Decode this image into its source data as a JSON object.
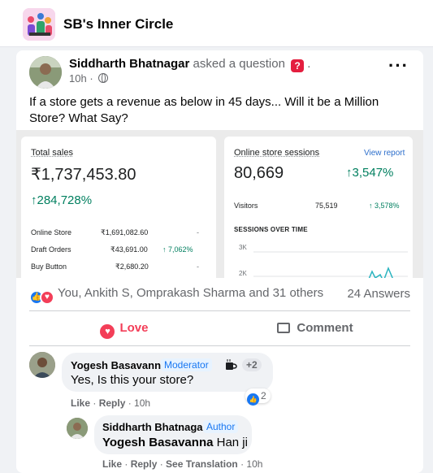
{
  "group": {
    "name": "SB's Inner Circle"
  },
  "post": {
    "author": "Siddharth Bhatnagar",
    "action": "asked a question",
    "time": "10h",
    "privacy_sep": "·",
    "text": "If a store gets a revenue as below in 45 days... Will it be a Million Store?  What Say?",
    "more_icon": "more-horizontal-icon"
  },
  "analytics": {
    "total_sales": {
      "label": "Total sales",
      "value": "₹1,737,453.80",
      "growth": "↑284,728%",
      "rows": [
        {
          "label": "Online Store",
          "value": "₹1,691,082.60",
          "growth": "-"
        },
        {
          "label": "Draft Orders",
          "value": "₹43,691.00",
          "growth": "↑ 7,062%"
        },
        {
          "label": "Buy Button",
          "value": "₹2,680.20",
          "growth": "-"
        }
      ]
    },
    "sessions": {
      "label": "Online store sessions",
      "link": "View report",
      "value": "80,669",
      "growth": "↑3,547%",
      "visitors_label": "Visitors",
      "visitors_value": "75,519",
      "visitors_growth": "↑ 3,578%",
      "chart_title": "SESSIONS OVER TIME",
      "axis_top": "3K",
      "axis_mid": "2K"
    }
  },
  "reactions": {
    "summary": "You, Ankith S, Omprakash Sharma and 31 others",
    "answers": "24 Answers"
  },
  "actions": {
    "love": "Love",
    "comment": "Comment"
  },
  "comments": [
    {
      "author": "Yogesh Basavanna",
      "badge": "Moderator",
      "extra": "+2",
      "text": "Yes, Is this your store?",
      "like": "Like",
      "reply": "Reply",
      "time": "10h",
      "likes": "2"
    },
    {
      "author": "Siddharth Bhatnagar",
      "badge": "Author",
      "mention": "Yogesh Basavanna",
      "text": "Han ji",
      "like": "Like",
      "reply": "Reply",
      "translation": "See Translation",
      "time": "10h"
    }
  ],
  "colors": {
    "facebook_blue": "#1877f2",
    "love_red": "#f33e58",
    "growth_green": "#007f5f"
  }
}
